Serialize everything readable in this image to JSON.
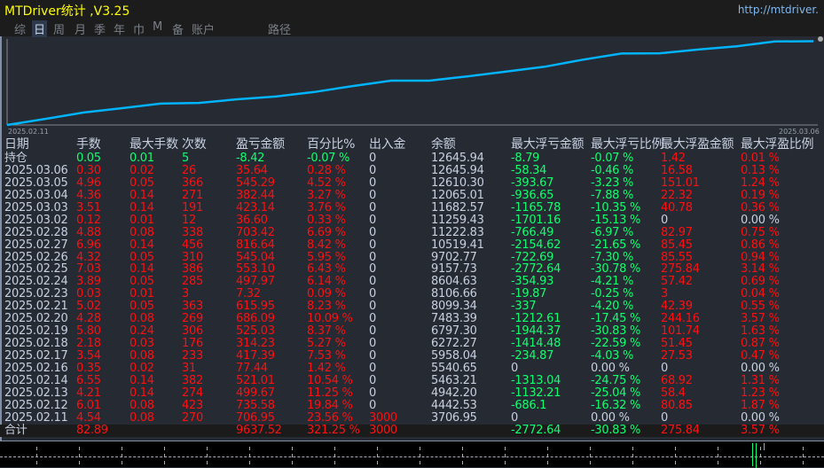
{
  "title": "MTDriver统计 ,V3.25",
  "url": "http://mtdriver.",
  "tabs": [
    "综",
    "日",
    "周",
    "月",
    "季",
    "年",
    "巾",
    "M",
    "备",
    "账户",
    "路径"
  ],
  "active_tab": 1,
  "colors": {
    "line": "#00b4ff",
    "profit": "#ff1010",
    "loss": "#10ff70",
    "text": "#c8d0e0",
    "title": "#ffff00"
  },
  "chart_data": {
    "type": "line",
    "x_start_label": "2025.02.11",
    "x_end_label": "2025.03.06",
    "values": [
      3000,
      3706.95,
      4442.53,
      4942.2,
      5463.21,
      5540.65,
      5958.04,
      6272.27,
      6797.3,
      7483.39,
      8099.34,
      8106.66,
      8604.63,
      9157.73,
      9702.77,
      10519.41,
      11222.83,
      11259.43,
      11682.57,
      12065.01,
      12610.3,
      12645.94
    ],
    "ylim": [
      3000,
      12900
    ]
  },
  "headers": [
    "日期",
    "手数",
    "最大手数",
    "次数",
    "盈亏金额",
    "百分比%",
    "出入金",
    "余额",
    "最大浮亏金额",
    "最大浮亏比例",
    "最大浮盈金额",
    "最大浮盈比例"
  ],
  "rows": [
    [
      "持仓",
      "0.05",
      "0.01",
      "5",
      "-8.42",
      "-0.07 %",
      "0",
      "12645.94",
      "-8.79",
      "-0.07 %",
      "1.42",
      "0.01 %"
    ],
    [
      "2025.03.06",
      "0.30",
      "0.02",
      "26",
      "35.64",
      "0.28 %",
      "0",
      "12645.94",
      "-58.34",
      "-0.46 %",
      "16.58",
      "0.13 %"
    ],
    [
      "2025.03.05",
      "4.96",
      "0.05",
      "366",
      "545.29",
      "4.52 %",
      "0",
      "12610.30",
      "-393.67",
      "-3.23 %",
      "151.01",
      "1.24 %"
    ],
    [
      "2025.03.04",
      "4.36",
      "0.14",
      "271",
      "382.44",
      "3.27 %",
      "0",
      "12065.01",
      "-936.65",
      "-7.88 %",
      "22.32",
      "0.19 %"
    ],
    [
      "2025.03.03",
      "3.51",
      "0.14",
      "191",
      "423.14",
      "3.76 %",
      "0",
      "11682.57",
      "-1165.78",
      "-10.35 %",
      "40.78",
      "0.36 %"
    ],
    [
      "2025.03.02",
      "0.12",
      "0.01",
      "12",
      "36.60",
      "0.33 %",
      "0",
      "11259.43",
      "-1701.16",
      "-15.13 %",
      "0",
      "0.00 %"
    ],
    [
      "2025.02.28",
      "4.88",
      "0.08",
      "338",
      "703.42",
      "6.69 %",
      "0",
      "11222.83",
      "-766.49",
      "-6.97 %",
      "82.97",
      "0.75 %"
    ],
    [
      "2025.02.27",
      "6.96",
      "0.14",
      "456",
      "816.64",
      "8.42 %",
      "0",
      "10519.41",
      "-2154.62",
      "-21.65 %",
      "85.45",
      "0.86 %"
    ],
    [
      "2025.02.26",
      "4.32",
      "0.05",
      "310",
      "545.04",
      "5.95 %",
      "0",
      "9702.77",
      "-722.69",
      "-7.30 %",
      "85.55",
      "0.94 %"
    ],
    [
      "2025.02.25",
      "7.03",
      "0.14",
      "386",
      "553.10",
      "6.43 %",
      "0",
      "9157.73",
      "-2772.64",
      "-30.78 %",
      "275.84",
      "3.14 %"
    ],
    [
      "2025.02.24",
      "3.89",
      "0.05",
      "285",
      "497.97",
      "6.14 %",
      "0",
      "8604.63",
      "-354.93",
      "-4.21 %",
      "57.42",
      "0.69 %"
    ],
    [
      "2025.02.23",
      "0.03",
      "0.01",
      "3",
      "7.32",
      "0.09 %",
      "0",
      "8106.66",
      "-19.87",
      "-0.25 %",
      "3",
      "0.04 %"
    ],
    [
      "2025.02.21",
      "5.02",
      "0.05",
      "363",
      "615.95",
      "8.23 %",
      "0",
      "8099.34",
      "-337",
      "-4.20 %",
      "42.39",
      "0.55 %"
    ],
    [
      "2025.02.20",
      "4.28",
      "0.08",
      "269",
      "686.09",
      "10.09 %",
      "0",
      "7483.39",
      "-1212.61",
      "-17.45 %",
      "244.16",
      "3.57 %"
    ],
    [
      "2025.02.19",
      "5.80",
      "0.24",
      "306",
      "525.03",
      "8.37 %",
      "0",
      "6797.30",
      "-1944.37",
      "-30.83 %",
      "101.74",
      "1.63 %"
    ],
    [
      "2025.02.18",
      "2.18",
      "0.03",
      "176",
      "314.23",
      "5.27 %",
      "0",
      "6272.27",
      "-1414.48",
      "-22.59 %",
      "51.45",
      "0.87 %"
    ],
    [
      "2025.02.17",
      "3.54",
      "0.08",
      "233",
      "417.39",
      "7.53 %",
      "0",
      "5958.04",
      "-234.87",
      "-4.03 %",
      "27.53",
      "0.47 %"
    ],
    [
      "2025.02.16",
      "0.35",
      "0.02",
      "31",
      "77.44",
      "1.42 %",
      "0",
      "5540.65",
      "0",
      "0.00 %",
      "0",
      "0.00 %"
    ],
    [
      "2025.02.14",
      "6.55",
      "0.14",
      "382",
      "521.01",
      "10.54 %",
      "0",
      "5463.21",
      "-1313.04",
      "-24.75 %",
      "68.92",
      "1.31 %"
    ],
    [
      "2025.02.13",
      "4.21",
      "0.14",
      "274",
      "499.67",
      "11.25 %",
      "0",
      "4942.20",
      "-1132.21",
      "-25.04 %",
      "58.4",
      "1.23 %"
    ],
    [
      "2025.02.12",
      "6.01",
      "0.08",
      "423",
      "735.58",
      "19.84 %",
      "0",
      "4442.53",
      "-686.1",
      "-16.32 %",
      "80.85",
      "1.87 %"
    ],
    [
      "2025.02.11",
      "4.54",
      "0.08",
      "270",
      "706.95",
      "23.56 %",
      "3000",
      "3706.95",
      "0",
      "0.00 %",
      "0",
      "0.00 %"
    ]
  ],
  "total": [
    "合计",
    "82.89",
    "",
    "",
    "9637.52",
    "321.25 %",
    "3000",
    "",
    "-2772.64",
    "-30.83 %",
    "275.84",
    "3.57 %"
  ]
}
